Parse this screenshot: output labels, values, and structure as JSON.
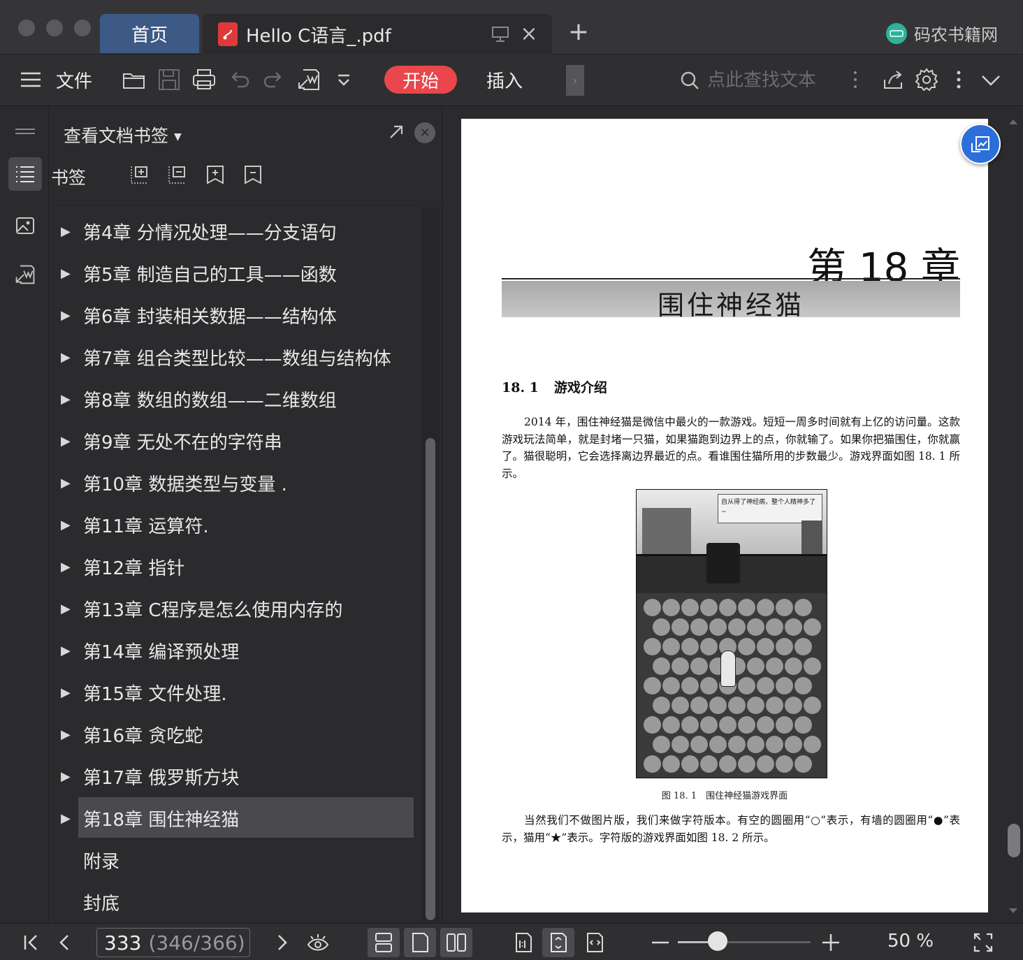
{
  "titlebar": {
    "tabs": [
      {
        "label": "首页",
        "active": false
      },
      {
        "label": "Hello C语言_.pdf",
        "active": true
      }
    ],
    "new_tab": "+",
    "brand": {
      "logo_text": "码农书籍网",
      "name": "码农书籍网"
    }
  },
  "toolbar": {
    "menu_label": "文件",
    "start_label": "开始",
    "insert_label": "插入",
    "search_placeholder": "点此查找文本",
    "accent_color": "#e9474b"
  },
  "bookmark_panel": {
    "title": "查看文档书签",
    "section_label": "书签",
    "items": [
      {
        "label": "第4章 分情况处理——分支语句",
        "expandable": true
      },
      {
        "label": "第5章 制造自己的工具——函数",
        "expandable": true
      },
      {
        "label": "第6章 封装相关数据——结构体",
        "expandable": true
      },
      {
        "label": "第7章 组合类型比较——数组与结构体",
        "expandable": true
      },
      {
        "label": "第8章 数组的数组——二维数组",
        "expandable": true
      },
      {
        "label": "第9章 无处不在的字符串",
        "expandable": true
      },
      {
        "label": "第10章 数据类型与变量 .",
        "expandable": true
      },
      {
        "label": "第11章 运算符.",
        "expandable": true
      },
      {
        "label": "第12章 指针",
        "expandable": true
      },
      {
        "label": "第13章 C程序是怎么使用内存的",
        "expandable": true
      },
      {
        "label": "第14章 编译预处理",
        "expandable": true
      },
      {
        "label": "第15章 文件处理.",
        "expandable": true
      },
      {
        "label": "第16章 贪吃蛇",
        "expandable": true
      },
      {
        "label": "第17章 俄罗斯方块",
        "expandable": true
      },
      {
        "label": "第18章 围住神经猫",
        "expandable": true,
        "selected": true
      },
      {
        "label": "附录",
        "expandable": false
      },
      {
        "label": "封底",
        "expandable": false
      }
    ]
  },
  "document": {
    "chapter_number": "第 18 章",
    "chapter_title": "围住神经猫",
    "section_number": "18. 1",
    "section_title": "游戏介绍",
    "paragraph1": "2014 年，围住神经猫是微信中最火的一款游戏。短短一周多时间就有上亿的访问量。这款游戏玩法简单，就是封堵一只猫，如果猫跑到边界上的点，你就输了。如果你把猫围住，你就赢了。猫很聪明，它会选择离边界最近的点。看谁围住猫所用的步数最少。游戏界面如图 18. 1 所示。",
    "figure_banner": "自从得了神经病，整个人精神多了~",
    "figure_caption": "图 18. 1　围住神经猫游戏界面",
    "paragraph2": "当然我们不做图片版，我们来做字符版本。有空的圆圈用“○”表示，有墙的圆圈用“●”表示，猫用“★”表示。字符版的游戏界面如图 18. 2 所示。"
  },
  "statusbar": {
    "current_page": "333",
    "page_of_total": "(346/366)",
    "zoom_label": "50 %",
    "zoom_fraction": 0.3
  }
}
